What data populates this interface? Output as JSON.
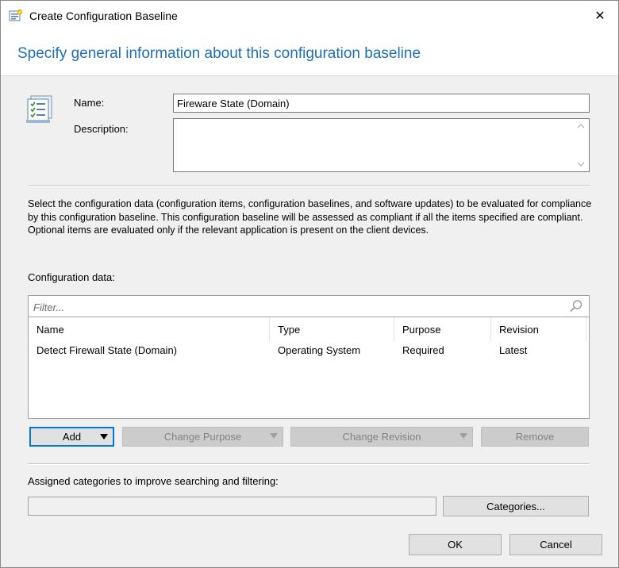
{
  "window": {
    "title": "Create Configuration Baseline",
    "close_glyph": "✕"
  },
  "header": {
    "title": "Specify general information about this configuration baseline"
  },
  "form": {
    "name_label": "Name:",
    "name_value": "Fireware State (Domain)",
    "description_label": "Description:",
    "description_value": ""
  },
  "info_text": "Select the configuration data (configuration items, configuration baselines, and software updates) to be evaluated for compliance by this configuration baseline. This configuration baseline will be assessed as compliant if all the items specified are compliant. Optional items are evaluated only if the relevant application is present on  the client devices.",
  "config_data": {
    "label": "Configuration data:",
    "filter_placeholder": "Filter...",
    "columns": [
      "Name",
      "Type",
      "Purpose",
      "Revision"
    ],
    "rows": [
      [
        "Detect Firewall State (Domain)",
        "Operating System",
        "Required",
        "Latest"
      ]
    ]
  },
  "actions": {
    "add": "Add",
    "change_purpose": "Change Purpose",
    "change_revision": "Change Revision",
    "remove": "Remove"
  },
  "categories": {
    "label": "Assigned categories to improve searching and filtering:",
    "value": "",
    "button": "Categories..."
  },
  "footer": {
    "ok": "OK",
    "cancel": "Cancel"
  },
  "icons": {
    "title": "configuration-baseline-icon",
    "page": "configuration-baseline-large-icon",
    "search": "search-icon",
    "dropdown": "triangle-down-icon"
  },
  "colors": {
    "header_title": "#1e6fb8",
    "focus_border": "#0078d7"
  }
}
